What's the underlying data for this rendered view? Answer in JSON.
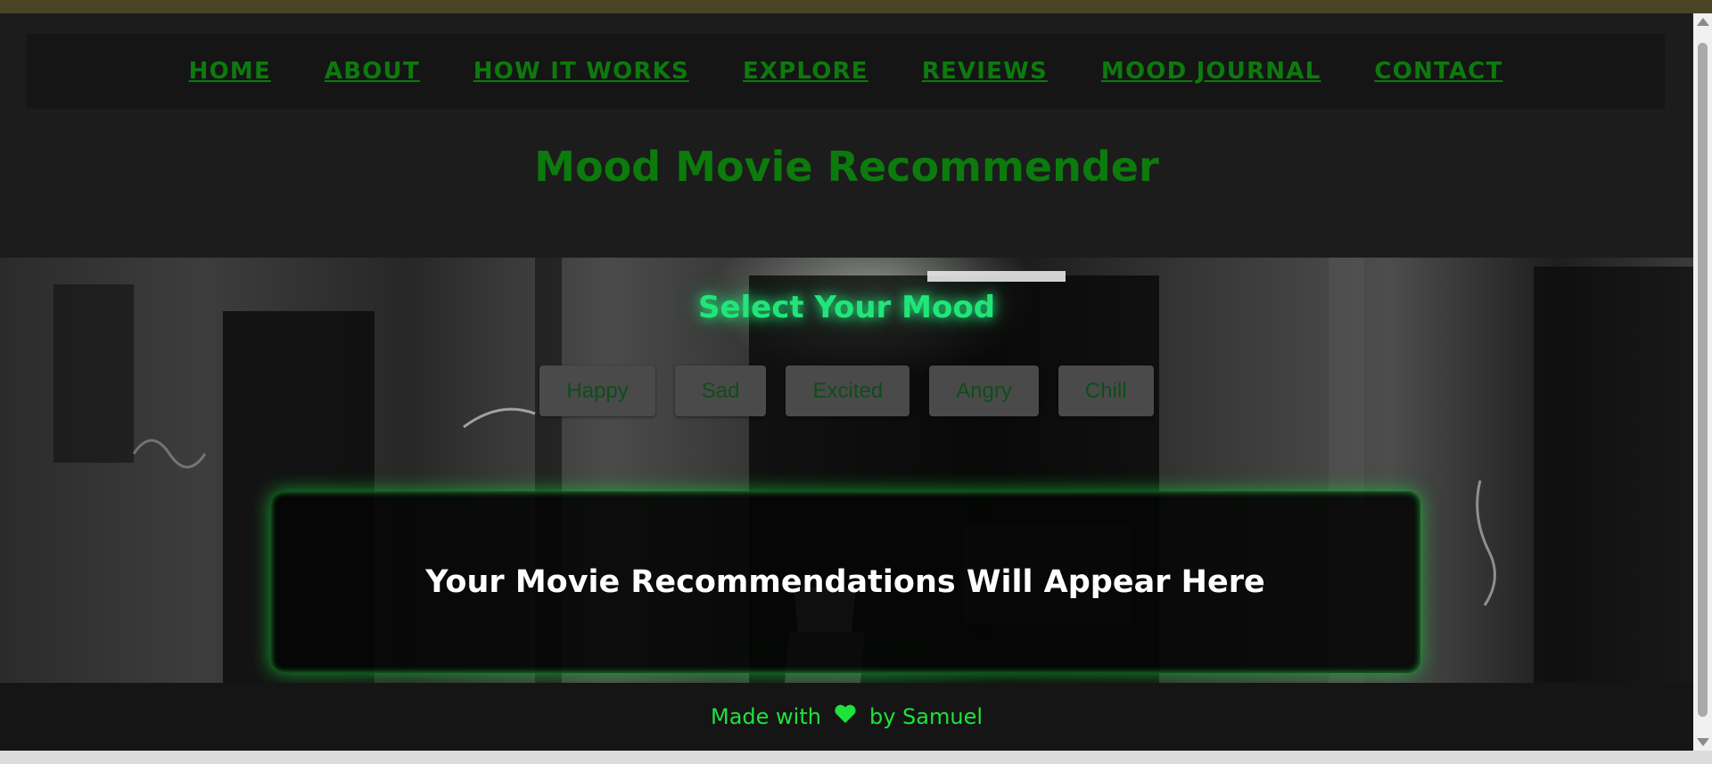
{
  "nav": {
    "items": [
      {
        "label": "HOME"
      },
      {
        "label": "ABOUT"
      },
      {
        "label": "HOW IT WORKS"
      },
      {
        "label": "EXPLORE"
      },
      {
        "label": "REVIEWS"
      },
      {
        "label": "MOOD JOURNAL"
      },
      {
        "label": "CONTACT"
      }
    ]
  },
  "header": {
    "title": "Mood Movie Recommender"
  },
  "moods": {
    "heading": "Select Your Mood",
    "buttons": [
      {
        "label": "Happy"
      },
      {
        "label": "Sad"
      },
      {
        "label": "Excited"
      },
      {
        "label": "Angry"
      },
      {
        "label": "Chill"
      }
    ]
  },
  "recommendations": {
    "placeholder": "Your Movie Recommendations Will Appear Here"
  },
  "footer": {
    "made_with": "Made with",
    "by": "by Samuel",
    "icon": "heart-icon"
  },
  "colors": {
    "nav_link": "#0c7a0c",
    "heading_glow": "#22e57a",
    "footer_text": "#1fe33b",
    "background": "#1c1c1c"
  }
}
